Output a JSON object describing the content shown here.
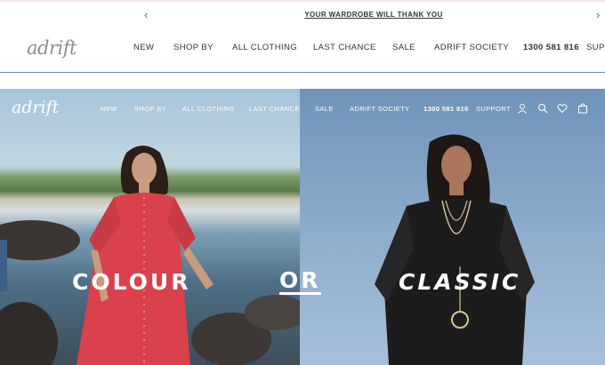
{
  "announcement": {
    "message": "YOUR WARDROBE WILL THANK YOU",
    "prev_icon": "chevron-left-icon",
    "next_icon": "chevron-right-icon"
  },
  "header": {
    "logo": "adrift",
    "nav": [
      "NEW",
      "SHOP BY",
      "ALL CLOTHING",
      "LAST CHANCE",
      "SALE",
      "ADRIFT SOCIETY"
    ],
    "phone": "1300 581 816",
    "support": "SUPP"
  },
  "hero": {
    "logo": "adrift",
    "nav": [
      "NEW",
      "SHOP BY",
      "ALL CLOTHING",
      "LAST CHANCE",
      "SALE",
      "ADRIFT SOCIETY"
    ],
    "phone": "1300 581 816",
    "support": "SUPPORT",
    "icons": [
      "account-icon",
      "search-icon",
      "wishlist-heart-icon",
      "cart-bag-icon"
    ],
    "headline_left": "COLOUR",
    "headline_middle": "OR",
    "headline_right": "CLASSIC",
    "colors": {
      "left_dress": "#d9424c",
      "right_dress": "#1c1c1c",
      "sky_right": "#7f9fc3"
    }
  }
}
